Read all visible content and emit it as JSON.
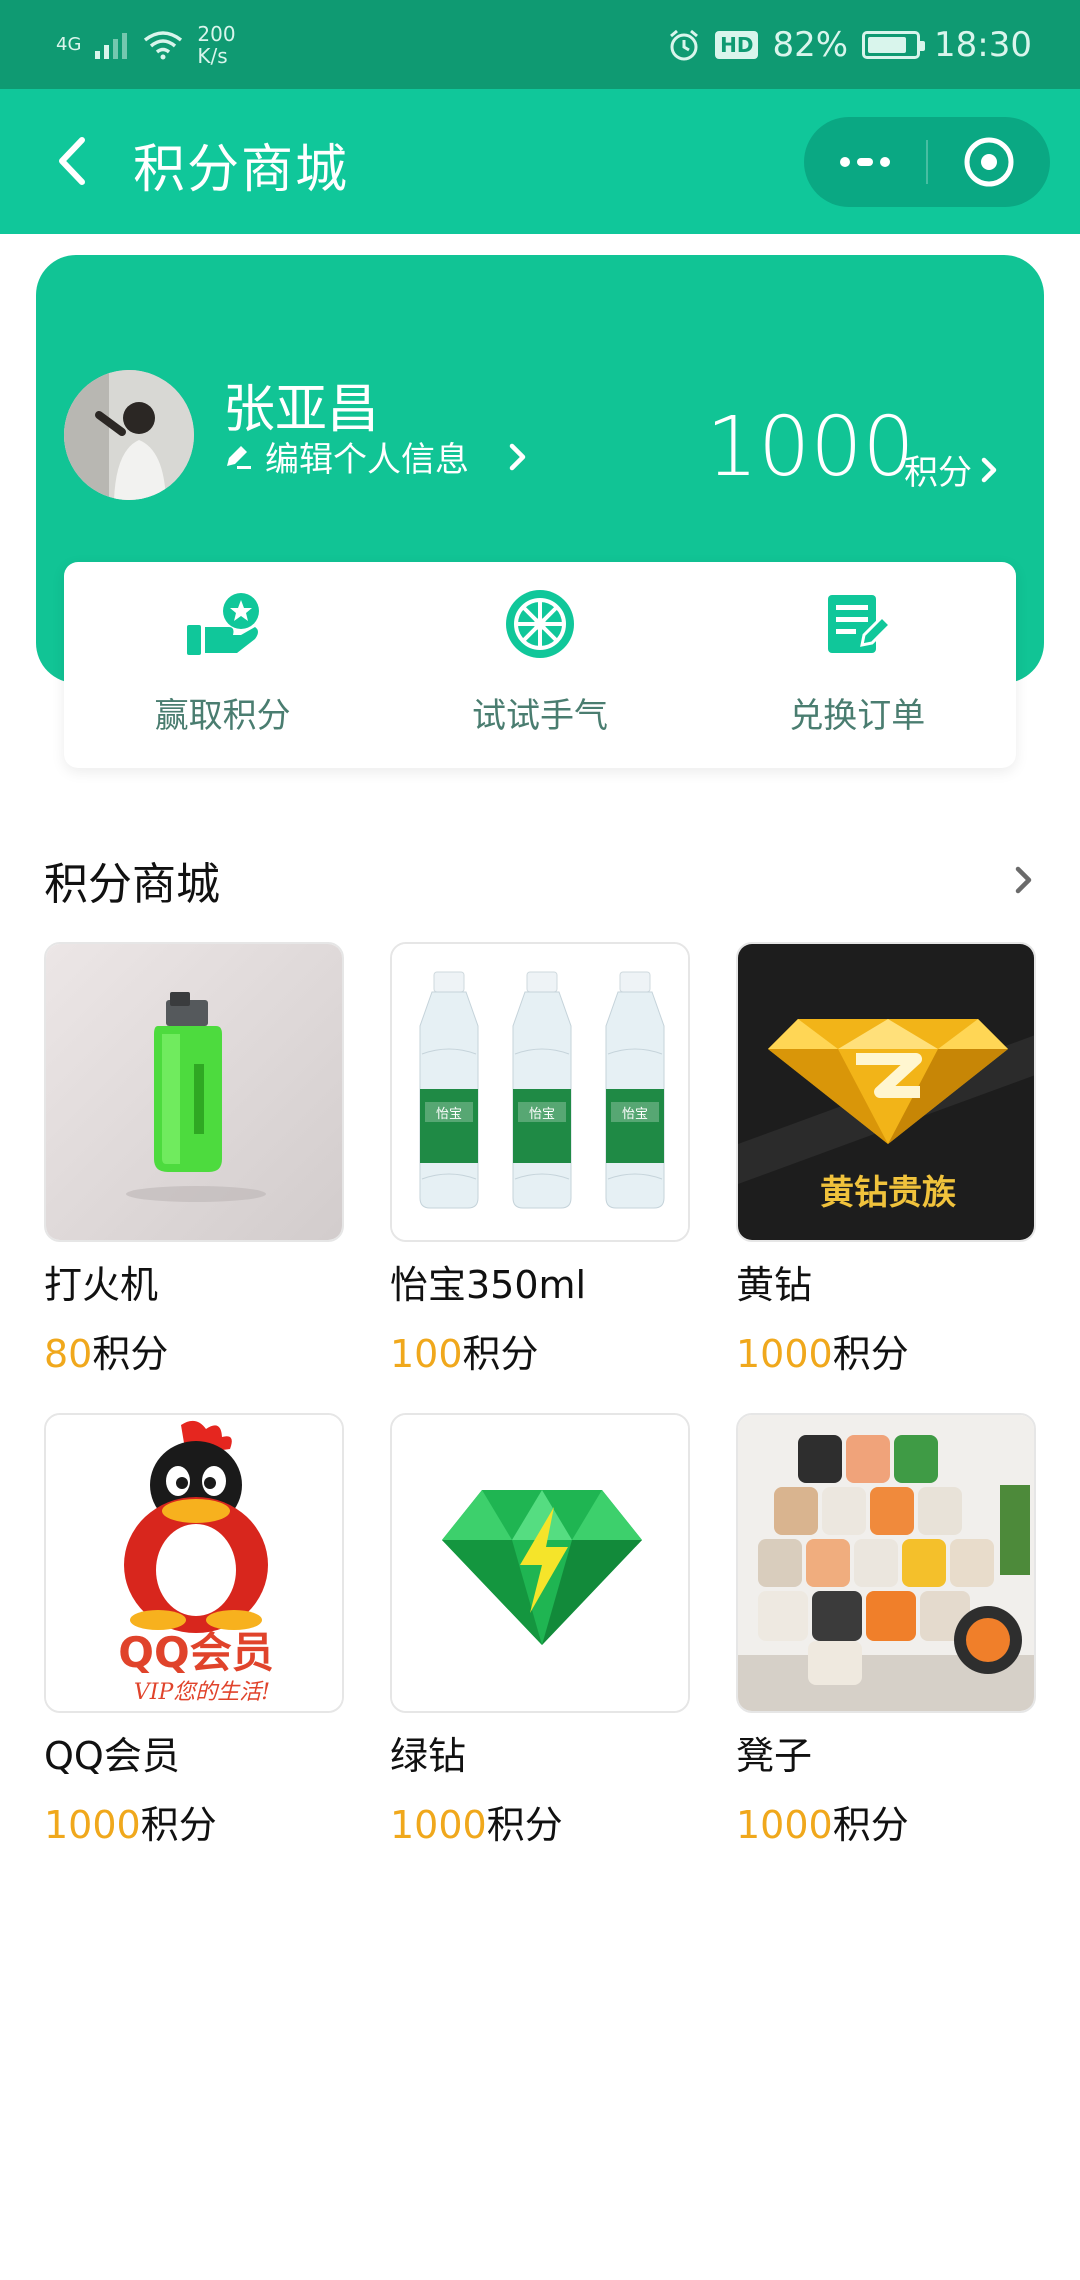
{
  "status_bar": {
    "network": "4G",
    "speed_value": "200",
    "speed_unit": "K/s",
    "hd": "HD",
    "battery_percent": "82%",
    "battery_level": 0.82,
    "time": "18:30"
  },
  "navbar": {
    "title": "积分商城",
    "icons": {
      "back": "chevron-left-icon",
      "more": "more-dots-icon",
      "close": "close-target-icon"
    }
  },
  "profile": {
    "name": "张亚昌",
    "edit_label": "编辑个人信息",
    "points": "1000",
    "points_unit": "积分"
  },
  "quick_actions": [
    {
      "label": "赢取积分",
      "icon": "earn-points-icon"
    },
    {
      "label": "试试手气",
      "icon": "lucky-wheel-icon"
    },
    {
      "label": "兑换订单",
      "icon": "order-edit-icon"
    }
  ],
  "mall": {
    "title": "积分商城",
    "products": [
      {
        "name": "打火机",
        "price": "80",
        "unit": "积分",
        "image": "lighter"
      },
      {
        "name": "怡宝350ml",
        "price": "100",
        "unit": "积分",
        "image": "water-bottles",
        "label_text": "怡宝"
      },
      {
        "name": "黄钻",
        "price": "1000",
        "unit": "积分",
        "image": "yellow-diamond",
        "label_text": "黄钻贵族"
      },
      {
        "name": "QQ会员",
        "price": "1000",
        "unit": "积分",
        "image": "qq-penguin",
        "label_text": "QQ会员",
        "slogan": "VIP您的生活!"
      },
      {
        "name": "绿钻",
        "price": "1000",
        "unit": "积分",
        "image": "green-diamond"
      },
      {
        "name": "凳子",
        "price": "1000",
        "unit": "积分",
        "image": "stools"
      }
    ]
  },
  "colors": {
    "brand": "#10c79a",
    "status_bar": "#0f9a72",
    "price": "#f0a81c"
  }
}
